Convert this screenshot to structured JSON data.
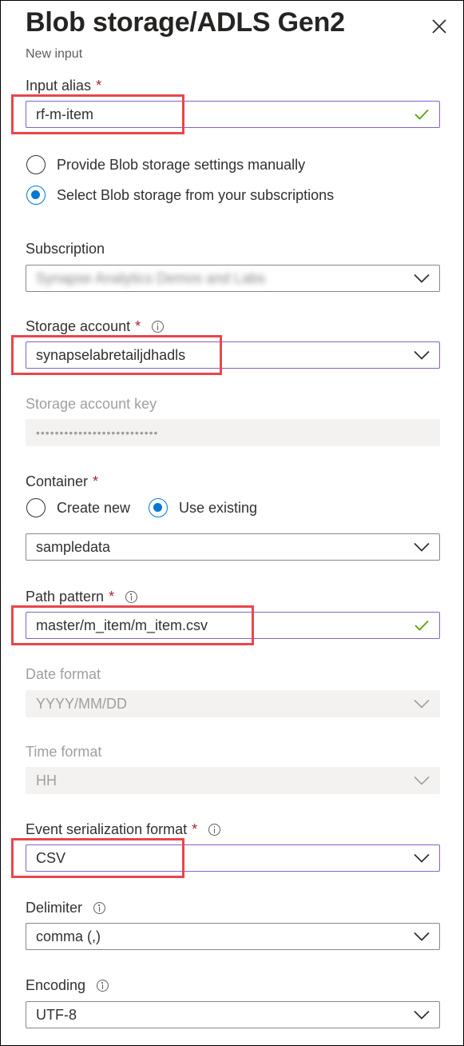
{
  "panel": {
    "title": "Blob storage/ADLS Gen2",
    "subtitle": "New input"
  },
  "input_alias": {
    "label": "Input alias",
    "required": "*",
    "value": "rf-m-item"
  },
  "source_options": [
    {
      "label": "Provide Blob storage settings manually",
      "selected": false
    },
    {
      "label": "Select Blob storage from your subscriptions",
      "selected": true
    }
  ],
  "subscription": {
    "label": "Subscription",
    "value": "Synapse Analytics Demos and Labs"
  },
  "storage_account": {
    "label": "Storage account",
    "required": "*",
    "value": "synapselabretailjdhadls"
  },
  "storage_account_key": {
    "label": "Storage account key",
    "value": "••••••••••••••••••••••••••"
  },
  "container": {
    "label": "Container",
    "required": "*",
    "options": [
      {
        "label": "Create new",
        "selected": false
      },
      {
        "label": "Use existing",
        "selected": true
      }
    ],
    "value": "sampledata"
  },
  "path_pattern": {
    "label": "Path pattern",
    "required": "*",
    "value": "master/m_item/m_item.csv"
  },
  "date_format": {
    "label": "Date format",
    "value": "YYYY/MM/DD"
  },
  "time_format": {
    "label": "Time format",
    "value": "HH"
  },
  "event_serialization": {
    "label": "Event serialization format",
    "required": "*",
    "value": "CSV"
  },
  "delimiter": {
    "label": "Delimiter",
    "value": "comma (,)"
  },
  "encoding": {
    "label": "Encoding",
    "value": "UTF-8"
  },
  "colors": {
    "accent": "#0078d4",
    "focus_border": "#8661c5",
    "required": "#a4262c",
    "highlight": "#e8474b",
    "valid": "#57a300"
  }
}
